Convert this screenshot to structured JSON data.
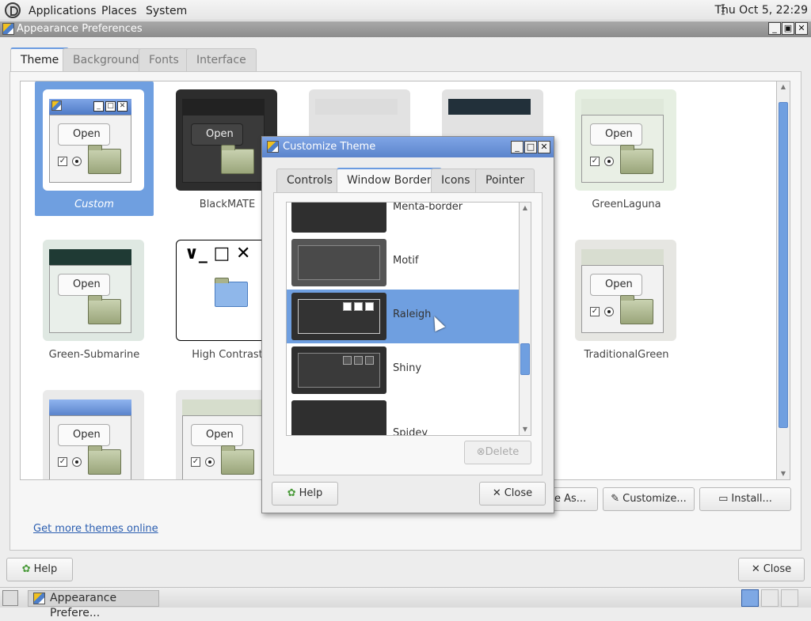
{
  "top_panel": {
    "menus": [
      "Applications",
      "Places",
      "System"
    ],
    "clock": "Thu Oct  5, 22:29"
  },
  "main_window": {
    "title": "Appearance Preferences",
    "tabs": [
      {
        "label": "Theme",
        "active": true
      },
      {
        "label": "Background",
        "active": false
      },
      {
        "label": "Fonts",
        "active": false
      },
      {
        "label": "Interface",
        "active": false
      }
    ],
    "themes": [
      {
        "name": "Custom",
        "selected": true
      },
      {
        "name": "BlackMATE"
      },
      {
        "name": "GreenLaguna"
      },
      {
        "name": "Green-Submarine"
      },
      {
        "name": "High Contrast"
      },
      {
        "name": "TraditionalGreen"
      }
    ],
    "preview_open_label": "Open",
    "get_more_link": "Get more themes online",
    "buttons": {
      "save_as": "e As...",
      "customize": "Customize...",
      "install": "Install...",
      "help": "Help",
      "close": "Close"
    }
  },
  "dialog": {
    "title": "Customize Theme",
    "tabs": [
      {
        "label": "Controls"
      },
      {
        "label": "Window Border",
        "active": true
      },
      {
        "label": "Icons"
      },
      {
        "label": "Pointer"
      }
    ],
    "window_borders": [
      {
        "name": "Menta-border"
      },
      {
        "name": "Motif"
      },
      {
        "name": "Raleigh",
        "selected": true
      },
      {
        "name": "Shiny"
      },
      {
        "name": "Spidey"
      }
    ],
    "delete_label": "Delete",
    "help_label": "Help",
    "close_label": "Close"
  },
  "taskbar": {
    "task_label": "Appearance Prefere..."
  },
  "colors": {
    "selection": "#6f9fe0",
    "dialog_titlebar": "#5b84cc",
    "main_titlebar": "#9a9a9a"
  }
}
